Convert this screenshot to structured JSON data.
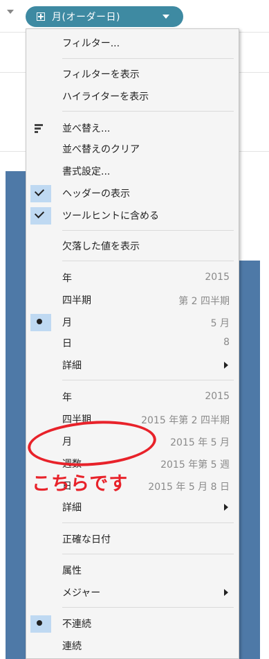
{
  "pill": {
    "label": "月(オーダー日)"
  },
  "menu": {
    "filter": "フィルター...",
    "show_filter": "フィルターを表示",
    "show_highlighter": "ハイライターを表示",
    "sort": "並べ替え...",
    "clear_sort": "並べ替えのクリア",
    "format": "書式設定...",
    "show_header": "ヘッダーの表示",
    "include_tooltip": "ツールヒントに含める",
    "show_missing": "欠落した値を表示",
    "discrete_dates": [
      {
        "label": "年",
        "value": "2015"
      },
      {
        "label": "四半期",
        "value": "第 2 四半期"
      },
      {
        "label": "月",
        "value": "5 月"
      },
      {
        "label": "日",
        "value": "8"
      },
      {
        "label": "詳細",
        "value": ""
      }
    ],
    "continuous_dates": [
      {
        "label": "年",
        "value": "2015"
      },
      {
        "label": "四半期",
        "value": "2015 年第 2 四半期"
      },
      {
        "label": "月",
        "value": "2015 年 5 月"
      },
      {
        "label": "週数",
        "value": "2015 年第 5 週"
      },
      {
        "label": "日",
        "value": "2015 年 5 月 8 日"
      },
      {
        "label": "詳細",
        "value": ""
      }
    ],
    "exact_date": "正確な日付",
    "attribute": "属性",
    "measure": "メジャー",
    "discrete": "不連続",
    "continuous": "連続"
  },
  "annotation": {
    "text": "こちらです",
    "color": "#e8222a"
  },
  "colors": {
    "pill": "#3e8aa2",
    "bars": "#4e79a7",
    "selection": "#bfd9f2"
  }
}
